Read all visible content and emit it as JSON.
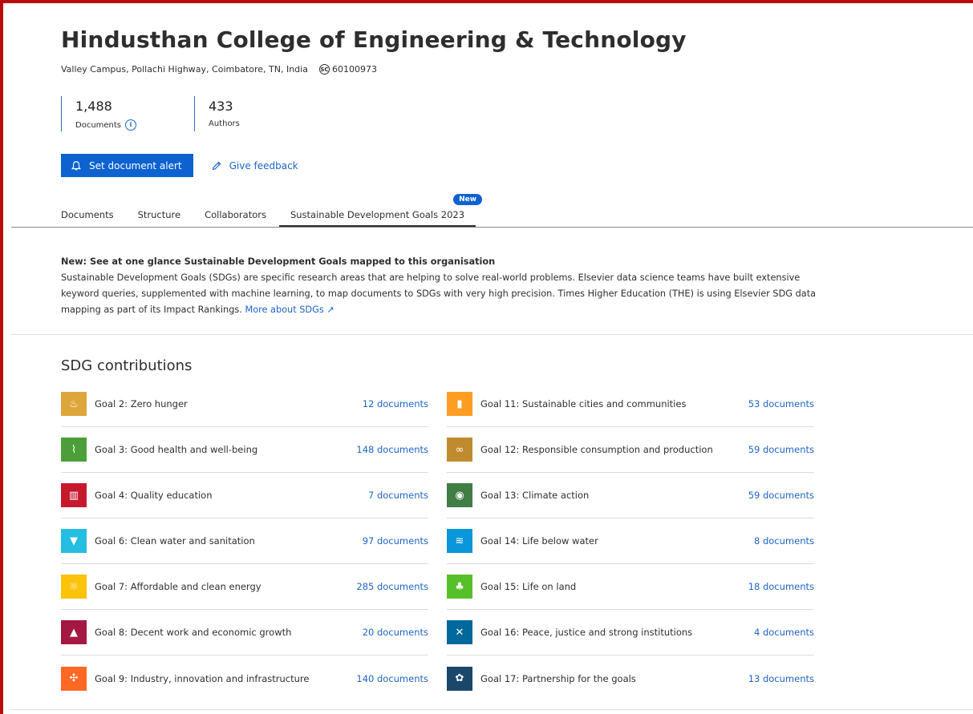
{
  "org": {
    "name": "Hindusthan College of Engineering & Technology",
    "address": "Valley Campus, Pollachi Highway, Coimbatore, TN, India",
    "id_badge": "SC",
    "id": "60100973"
  },
  "metrics": {
    "documents": {
      "value": "1,488",
      "label": "Documents",
      "info_icon": "i"
    },
    "authors": {
      "value": "433",
      "label": "Authors"
    }
  },
  "actions": {
    "alert_label": "Set document alert",
    "feedback_label": "Give feedback"
  },
  "tabs": [
    {
      "label": "Documents"
    },
    {
      "label": "Structure"
    },
    {
      "label": "Collaborators"
    },
    {
      "label": "Sustainable Development Goals 2023",
      "badge": "New",
      "active": true
    }
  ],
  "intro": {
    "heading": "New: See at one glance Sustainable Development Goals mapped to this organisation",
    "body": "Sustainable Development Goals (SDGs) are specific research areas that are helping to solve real-world problems. Elsevier data science teams have built extensive keyword queries, supplemented with machine learning, to map documents to SDGs with very high precision. Times Higher Education (THE) is using Elsevier SDG data mapping as part of its Impact Rankings.",
    "link": "More about SDGs ↗"
  },
  "sdg": {
    "title": "SDG contributions",
    "left": [
      {
        "label": "Goal 2: Zero hunger",
        "docs": "12 documents",
        "color": "#dda63a",
        "icon": "bowl",
        "glyph": "♨"
      },
      {
        "label": "Goal 3: Good health and well-being",
        "docs": "148 documents",
        "color": "#4c9f38",
        "icon": "heartbeat",
        "glyph": "⌇"
      },
      {
        "label": "Goal 4: Quality education",
        "docs": "7 documents",
        "color": "#c5192d",
        "icon": "book",
        "glyph": "▥"
      },
      {
        "label": "Goal 6: Clean water and sanitation",
        "docs": "97 documents",
        "color": "#26bde2",
        "icon": "cup",
        "glyph": "▼"
      },
      {
        "label": "Goal 7: Affordable and clean energy",
        "docs": "285 documents",
        "color": "#fcc30b",
        "icon": "sun",
        "glyph": "☼"
      },
      {
        "label": "Goal 8: Decent work and economic growth",
        "docs": "20 documents",
        "color": "#a21942",
        "icon": "growth",
        "glyph": "▲"
      },
      {
        "label": "Goal 9: Industry, innovation and infrastructure",
        "docs": "140 documents",
        "color": "#fd6925",
        "icon": "cubes",
        "glyph": "✣"
      }
    ],
    "right": [
      {
        "label": "Goal 11: Sustainable cities and communities",
        "docs": "53 documents",
        "color": "#fd9d24",
        "icon": "city",
        "glyph": "▮"
      },
      {
        "label": "Goal 12: Responsible consumption and production",
        "docs": "59 documents",
        "color": "#bf8b2e",
        "icon": "infinity",
        "glyph": "∞"
      },
      {
        "label": "Goal 13: Climate action",
        "docs": "59 documents",
        "color": "#3f7e44",
        "icon": "eye",
        "glyph": "◉"
      },
      {
        "label": "Goal 14: Life below water",
        "docs": "8 documents",
        "color": "#0a97d9",
        "icon": "fish",
        "glyph": "≋"
      },
      {
        "label": "Goal 15: Life on land",
        "docs": "18 documents",
        "color": "#56c02b",
        "icon": "tree",
        "glyph": "♣"
      },
      {
        "label": "Goal 16: Peace, justice and strong institutions",
        "docs": "4 documents",
        "color": "#00689d",
        "icon": "dove",
        "glyph": "✕"
      },
      {
        "label": "Goal 17: Partnership for the goals",
        "docs": "13 documents",
        "color": "#19486a",
        "icon": "flower",
        "glyph": "✿"
      }
    ]
  }
}
